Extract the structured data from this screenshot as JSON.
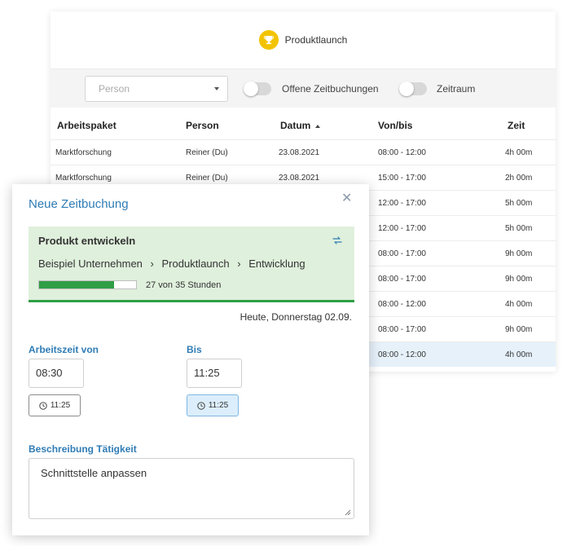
{
  "project": {
    "name": "Produktlaunch",
    "icon": "trophy-icon",
    "icon_color": "#f2c300"
  },
  "filters": {
    "person_placeholder": "Person",
    "toggle_open_label": "Offene Zeitbuchungen",
    "toggle_range_label": "Zeitraum"
  },
  "table": {
    "headers": [
      "Arbeitspaket",
      "Person",
      "Datum",
      "Von/bis",
      "Zeit"
    ],
    "sort_column": "Datum",
    "rows": [
      [
        "Marktforschung",
        "Reiner (Du)",
        "23.08.2021",
        "08:00 - 12:00",
        "4h 00m"
      ],
      [
        "Marktforschung",
        "Reiner (Du)",
        "23.08.2021",
        "15:00 - 17:00",
        "2h 00m"
      ],
      [
        "",
        "",
        "",
        "12:00 - 17:00",
        "5h 00m"
      ],
      [
        "",
        "",
        "",
        "12:00 - 17:00",
        "5h 00m"
      ],
      [
        "",
        "",
        "",
        "08:00 - 17:00",
        "9h 00m"
      ],
      [
        "",
        "",
        "",
        "08:00 - 17:00",
        "9h 00m"
      ],
      [
        "",
        "",
        "",
        "08:00 - 12:00",
        "4h 00m"
      ],
      [
        "",
        "",
        "",
        "08:00 - 17:00",
        "9h 00m"
      ],
      [
        "",
        "",
        "",
        "08:00 - 12:00",
        "4h 00m"
      ]
    ],
    "highlight_row": 8
  },
  "modal": {
    "title": "Neue Zeitbuchung",
    "close_icon": "close-icon",
    "task": {
      "title": "Produkt entwickeln",
      "breadcrumb": [
        "Beispiel Unternehmen",
        "Produktlaunch",
        "Entwicklung"
      ],
      "breadcrumb_separator": "›",
      "progress_text": "27 von 35 Stunden",
      "progress_fraction": 0.7714,
      "color": "#2f9e45"
    },
    "date": "Heute, Donnerstag 02.09.",
    "from": {
      "label": "Arbeitszeit von",
      "value": "08:30",
      "now_button": "11:25"
    },
    "to": {
      "label": "Bis",
      "value": "11:25",
      "now_button": "11:25"
    },
    "description": {
      "label": "Beschreibung Tätigkeit",
      "value": "Schnittstelle anpassen"
    }
  },
  "colors": {
    "accent": "#2f7cb5",
    "highlight_row": "#e6f1fa"
  }
}
